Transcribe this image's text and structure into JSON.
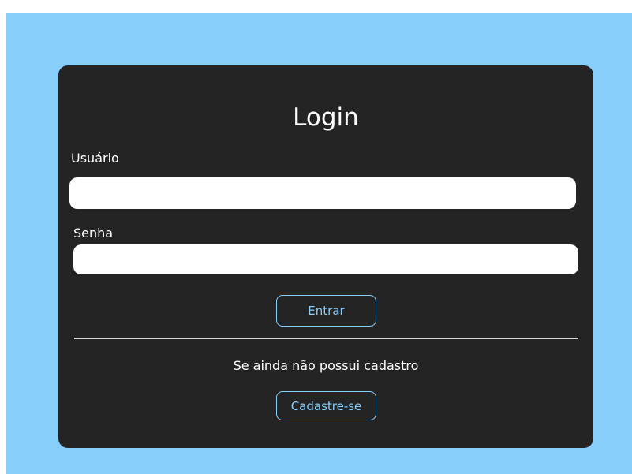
{
  "login": {
    "title": "Login",
    "username_label": "Usuário",
    "username_value": "",
    "password_label": "Senha",
    "password_value": "",
    "submit_label": "Entrar",
    "signup_prompt": "Se ainda não possui cadastro",
    "signup_label": "Cadastre-se"
  },
  "colors": {
    "background": "#87cefa",
    "card": "#242424",
    "accent": "#87cefa",
    "divider": "#d9d9d9"
  }
}
